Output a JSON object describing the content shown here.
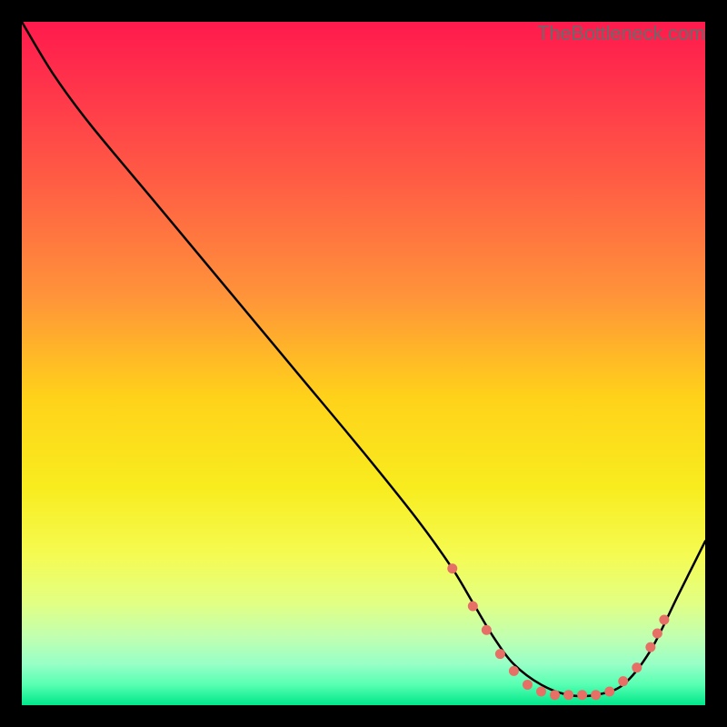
{
  "watermark": "TheBottleneck.com",
  "chart_data": {
    "type": "line",
    "title": "",
    "xlabel": "",
    "ylabel": "",
    "xlim": [
      0,
      100
    ],
    "ylim": [
      0,
      100
    ],
    "axes_visible": false,
    "grid": false,
    "background": "rainbow-vertical-gradient",
    "gradient_stops": [
      {
        "pos": 0.0,
        "color": "#ff1a4d"
      },
      {
        "pos": 0.12,
        "color": "#ff3b4a"
      },
      {
        "pos": 0.25,
        "color": "#ff6243"
      },
      {
        "pos": 0.4,
        "color": "#ff933a"
      },
      {
        "pos": 0.55,
        "color": "#ffd21a"
      },
      {
        "pos": 0.68,
        "color": "#f8ec1e"
      },
      {
        "pos": 0.78,
        "color": "#f5fb52"
      },
      {
        "pos": 0.85,
        "color": "#e2ff83"
      },
      {
        "pos": 0.9,
        "color": "#c1ffb0"
      },
      {
        "pos": 0.94,
        "color": "#97ffc7"
      },
      {
        "pos": 0.97,
        "color": "#57ffb2"
      },
      {
        "pos": 1.0,
        "color": "#00e78a"
      }
    ],
    "series": [
      {
        "name": "bottleneck-curve",
        "x": [
          0.0,
          4.5,
          10.0,
          20.0,
          30.0,
          40.0,
          50.0,
          58.0,
          63.0,
          66.0,
          69.0,
          72.0,
          76.0,
          80.0,
          84.0,
          88.0,
          92.0,
          96.0,
          100.0
        ],
        "y": [
          100.0,
          92.5,
          85.0,
          73.0,
          61.0,
          49.0,
          37.0,
          27.0,
          20.0,
          15.0,
          10.0,
          6.0,
          3.0,
          1.5,
          1.5,
          3.0,
          8.0,
          16.0,
          24.0
        ]
      }
    ],
    "markers": {
      "name": "highlight-points",
      "color": "#e77066",
      "radius": 5.5,
      "points": [
        {
          "x": 63.0,
          "y": 20.0
        },
        {
          "x": 66.0,
          "y": 14.5
        },
        {
          "x": 68.0,
          "y": 11.0
        },
        {
          "x": 70.0,
          "y": 7.5
        },
        {
          "x": 72.0,
          "y": 5.0
        },
        {
          "x": 74.0,
          "y": 3.0
        },
        {
          "x": 76.0,
          "y": 2.0
        },
        {
          "x": 78.0,
          "y": 1.5
        },
        {
          "x": 80.0,
          "y": 1.5
        },
        {
          "x": 82.0,
          "y": 1.5
        },
        {
          "x": 84.0,
          "y": 1.5
        },
        {
          "x": 86.0,
          "y": 2.0
        },
        {
          "x": 88.0,
          "y": 3.5
        },
        {
          "x": 90.0,
          "y": 5.5
        },
        {
          "x": 92.0,
          "y": 8.5
        },
        {
          "x": 93.0,
          "y": 10.5
        },
        {
          "x": 94.0,
          "y": 12.5
        }
      ]
    }
  }
}
